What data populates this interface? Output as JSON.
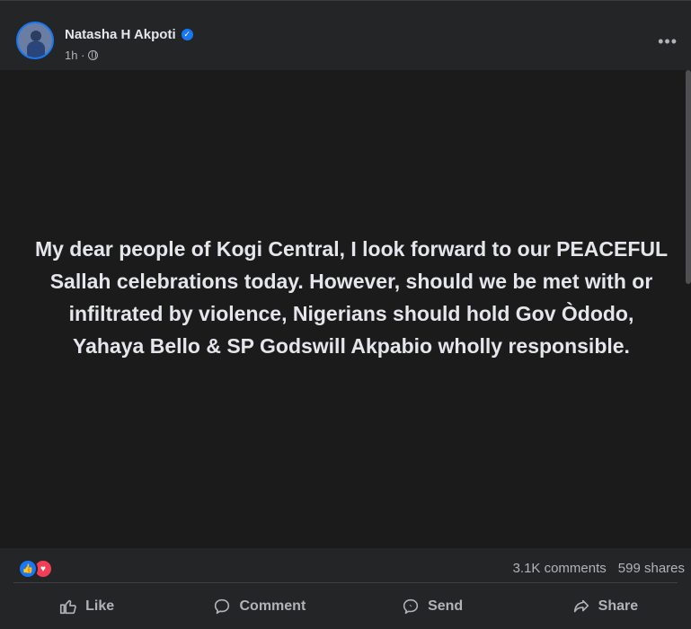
{
  "post": {
    "author": "Natasha H Akpoti",
    "time": "1h · ",
    "text": "My dear people of Kogi Central, I look forward to our PEACEFUL Sallah celebrations today. However, should we be met with or infiltrated by violence, Nigerians should hold Gov Òdodo, Yahaya Bello & SP Godswill Akpabio wholly responsible."
  },
  "stats": {
    "comments": "3.1K comments",
    "shares": "599 shares"
  },
  "actions": {
    "like": "Like",
    "comment": "Comment",
    "send": "Send",
    "share": "Share"
  },
  "colors": {
    "accent": "#1877f2",
    "love": "#f33e58",
    "background": "#242526",
    "post_background": "#1b1b1b"
  },
  "icons": [
    "verified-icon",
    "globe-icon",
    "more-icon",
    "like-icon",
    "comment-icon",
    "send-icon",
    "share-icon"
  ]
}
